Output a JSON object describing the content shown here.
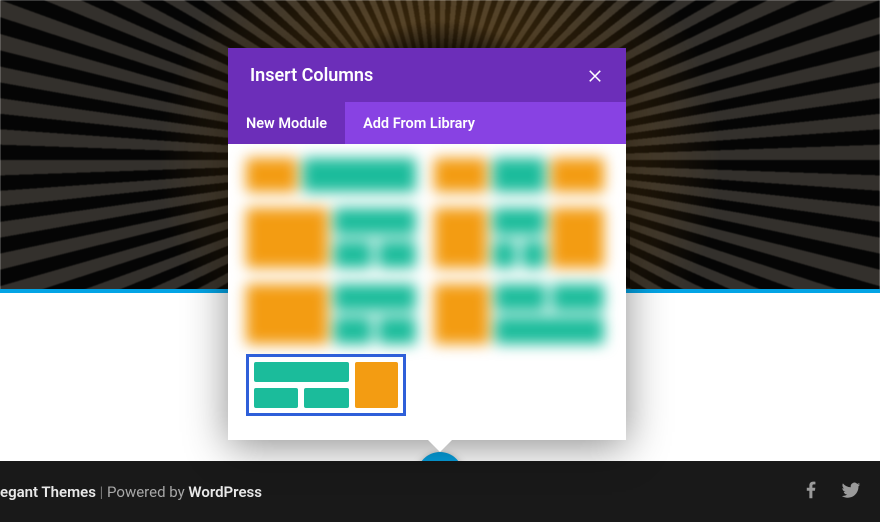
{
  "modal": {
    "title": "Insert Columns",
    "tabs": {
      "new_module": "New Module",
      "add_library": "Add From Library"
    }
  },
  "footer": {
    "brand": "egant Themes",
    "sep": " | ",
    "powered_prefix": "Powered by ",
    "powered_name": "WordPress"
  }
}
